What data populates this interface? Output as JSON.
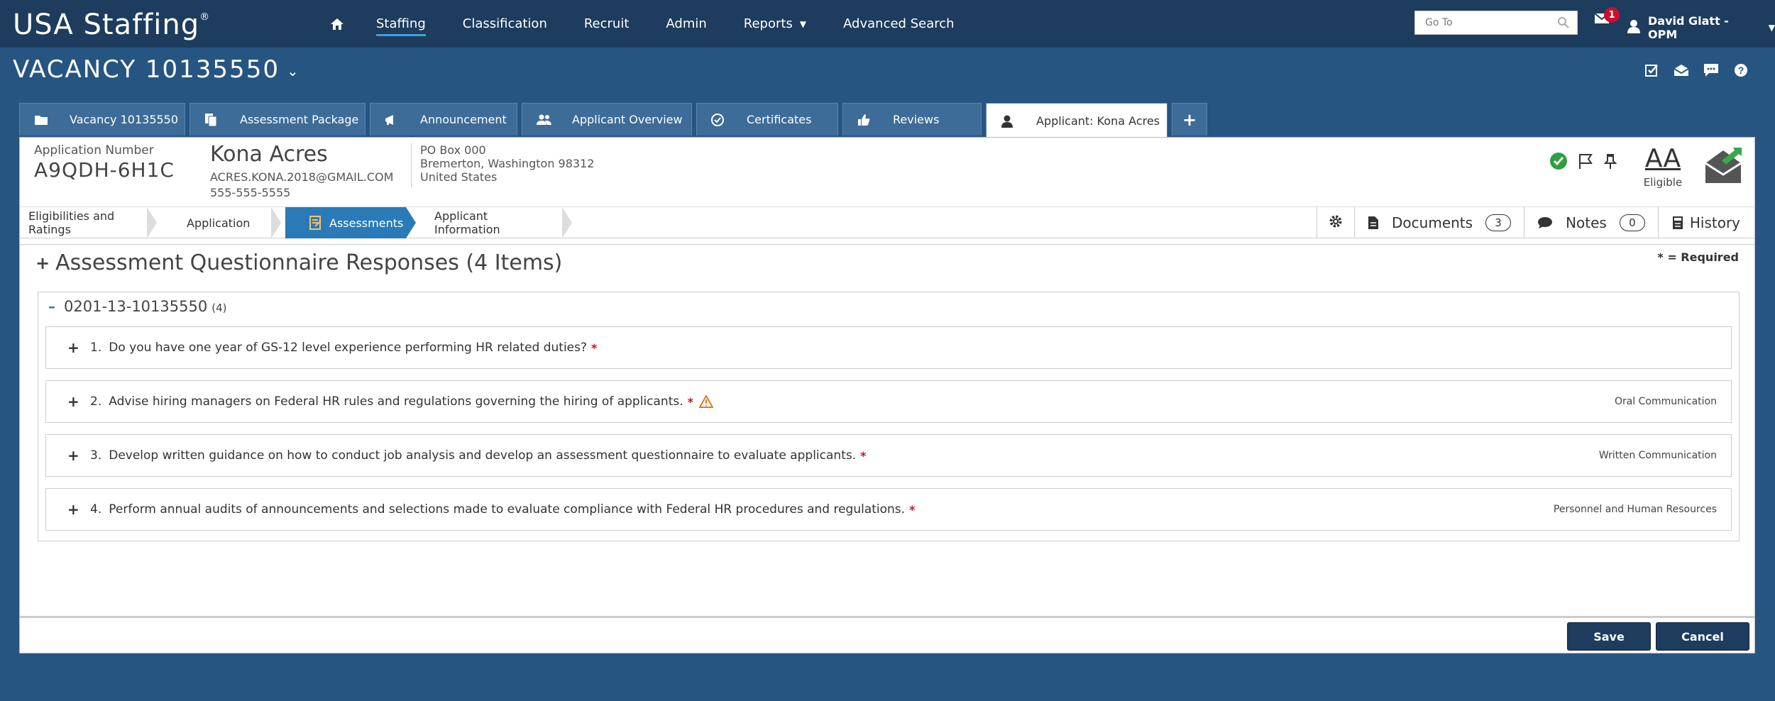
{
  "app": {
    "logo": "USA Staffing",
    "logo_mark": "®"
  },
  "nav": {
    "items": [
      "Staffing",
      "Classification",
      "Recruit",
      "Admin",
      "Reports",
      "Advanced Search"
    ],
    "active": "Staffing"
  },
  "goto": {
    "placeholder": "Go To"
  },
  "notifications": {
    "count": "1"
  },
  "user": {
    "name": "David Glatt - OPM"
  },
  "vacancy": {
    "title": "VACANCY 10135550"
  },
  "tabs": [
    {
      "label": "Vacancy 10135550",
      "icon": "folder-icon"
    },
    {
      "label": "Assessment Package",
      "icon": "documents-icon"
    },
    {
      "label": "Announcement",
      "icon": "megaphone-icon"
    },
    {
      "label": "Applicant Overview",
      "icon": "users-icon"
    },
    {
      "label": "Certificates",
      "icon": "check-circle-icon"
    },
    {
      "label": "Reviews",
      "icon": "thumbs-up-icon"
    },
    {
      "label": "Applicant: Kona Acres",
      "icon": "user-icon"
    }
  ],
  "applicant": {
    "app_num_label": "Application Number",
    "app_num": "A9QDH-6H1C",
    "name": "Kona Acres",
    "email": "ACRES.KONA.2018@GMAIL.COM",
    "phone": "555-555-5555",
    "address1": "PO Box 000",
    "address2": "Bremerton, Washington 98312",
    "address3": "United States",
    "initials": "AA",
    "status": "Eligible"
  },
  "crumbs": [
    "Eligibilities and Ratings",
    "Application",
    "Assessments",
    "Applicant Information"
  ],
  "tools": {
    "documents_label": "Documents",
    "documents_count": "3",
    "notes_label": "Notes",
    "notes_count": "0",
    "history_label": "History"
  },
  "section": {
    "plus": "+",
    "title": "Assessment Questionnaire Responses (4 Items)",
    "required_note": "* = Required"
  },
  "group": {
    "minus": "–",
    "id": "0201-13-10135550",
    "count": "(4)"
  },
  "questions": [
    {
      "num": "1.",
      "text": "Do you have one year of GS-12 level experience performing HR related duties?",
      "category": ""
    },
    {
      "num": "2.",
      "text": "Advise hiring managers on Federal HR rules and regulations governing the hiring of applicants.",
      "category": "Oral Communication"
    },
    {
      "num": "3.",
      "text": "Develop written guidance on how to conduct job analysis and develop an assessment questionnaire to evaluate applicants.",
      "category": "Written Communication"
    },
    {
      "num": "4.",
      "text": "Perform annual audits of announcements and selections made to evaluate compliance with Federal HR procedures and regulations.",
      "category": "Personnel and Human Resources"
    }
  ],
  "required_mark": "*",
  "buttons": {
    "save": "Save",
    "cancel": "Cancel"
  },
  "colors": {
    "header": "#1d3c5e",
    "body": "#275582",
    "accent": "#2a7ab8",
    "required": "#c8102e",
    "warning": "#e07a1f"
  }
}
